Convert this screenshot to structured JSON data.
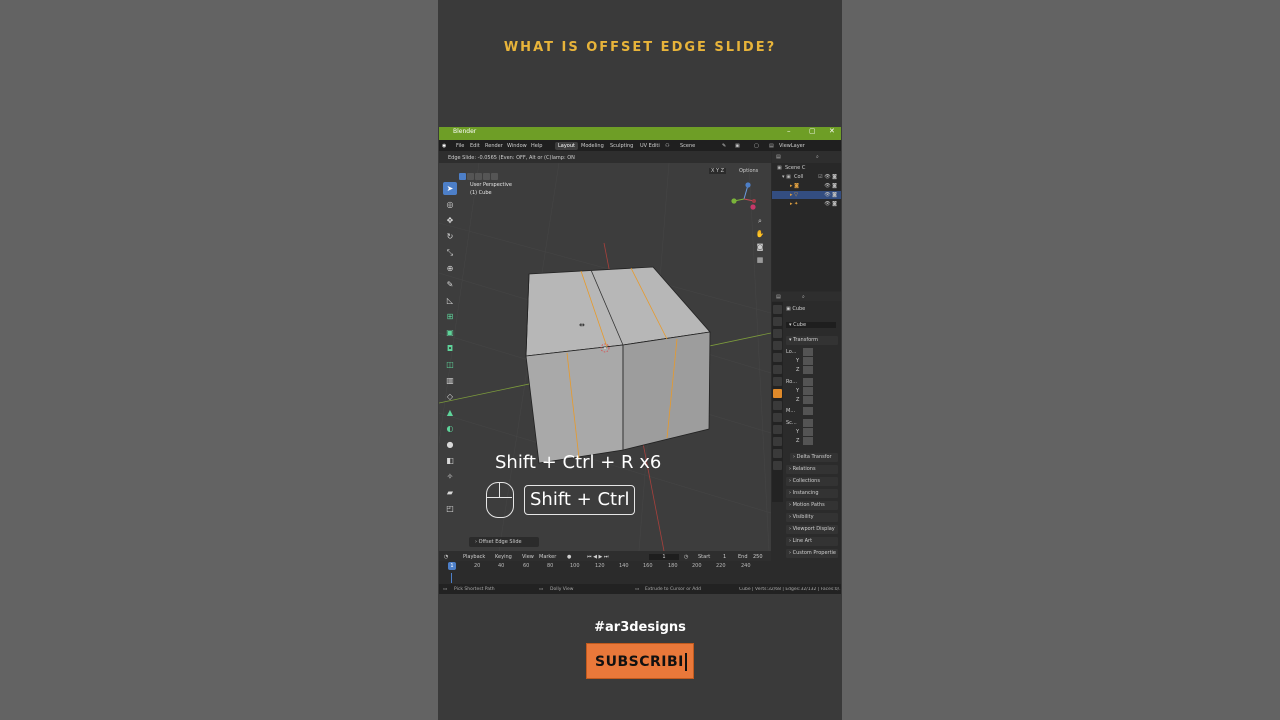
{
  "promo": {
    "title": "WHAT IS OFFSET EDGE SLIDE?",
    "hashtag": "#ar3designs",
    "subscribe_label": "SUBSCRIBI"
  },
  "window": {
    "title": "Blender",
    "controls": [
      "–",
      "▢",
      "✕"
    ]
  },
  "menubar": {
    "menus": [
      "File",
      "Edit",
      "Render",
      "Window",
      "Help"
    ],
    "workspaces": [
      "Layout",
      "Modeling",
      "Sculpting",
      "UV Editi"
    ],
    "active_workspace": "Layout",
    "scene_label": "Scene",
    "view_layer_label": "ViewLayer"
  },
  "viewport": {
    "header_hint": "Edge Slide: -0.0565 (Even: OFF, Alt or (C)lamp: ON",
    "info_line1": "User Perspective",
    "info_line2": "(1) Cube",
    "options_label": "Options",
    "axes_label": "X Y Z",
    "shortcut_text": "Shift + Ctrl + R x6",
    "key_badge_text": "Shift + Ctrl",
    "operator_panel": "Offset Edge Slide"
  },
  "outliner": {
    "rows": [
      {
        "label": "Scene C",
        "icons": ""
      },
      {
        "label": "Coll",
        "icons": "☑ 👁 ◙"
      },
      {
        "label": "",
        "icons": "👁 ◙"
      },
      {
        "label": "",
        "icons": "👁 ◙"
      },
      {
        "label": "",
        "icons": "👁 ◙"
      }
    ]
  },
  "properties": {
    "object_name": "Cube",
    "mesh_name": "Cube",
    "transform_label": "Transform",
    "location_label": "Lo...",
    "rotation_label": "Ro...",
    "mode_label": "M...",
    "scale_label": "Sc...",
    "axis_y": "Y",
    "axis_z": "Z",
    "sections": [
      "Delta Transfor",
      "Relations",
      "Collections",
      "Instancing",
      "Motion Paths",
      "Visibility",
      "Viewport Display",
      "Line Art",
      "Custom Propertie"
    ]
  },
  "timeline": {
    "menus": [
      "Playback",
      "Keying",
      "View",
      "Marker"
    ],
    "current_frame": "1",
    "start_label": "Start",
    "start_value": "1",
    "end_label": "End",
    "end_value": "250",
    "ruler": [
      "1",
      "20",
      "40",
      "60",
      "80",
      "100",
      "120",
      "140",
      "160",
      "180",
      "200",
      "220",
      "240"
    ]
  },
  "statusbar": {
    "left": "Pick Shortest Path",
    "middle": "Dolly View",
    "right_action": "Extrude to Cursor or Add",
    "stats": "Cube | Verts:32/68 | Edges:32/132 | Faces:0/..."
  },
  "colors": {
    "promo_title": "#e8b43a",
    "titlebar": "#6e9e26",
    "selection_blue": "#4d7fc8",
    "edge_orange": "#e89a2a",
    "subscribe_bg": "#e9783a"
  }
}
